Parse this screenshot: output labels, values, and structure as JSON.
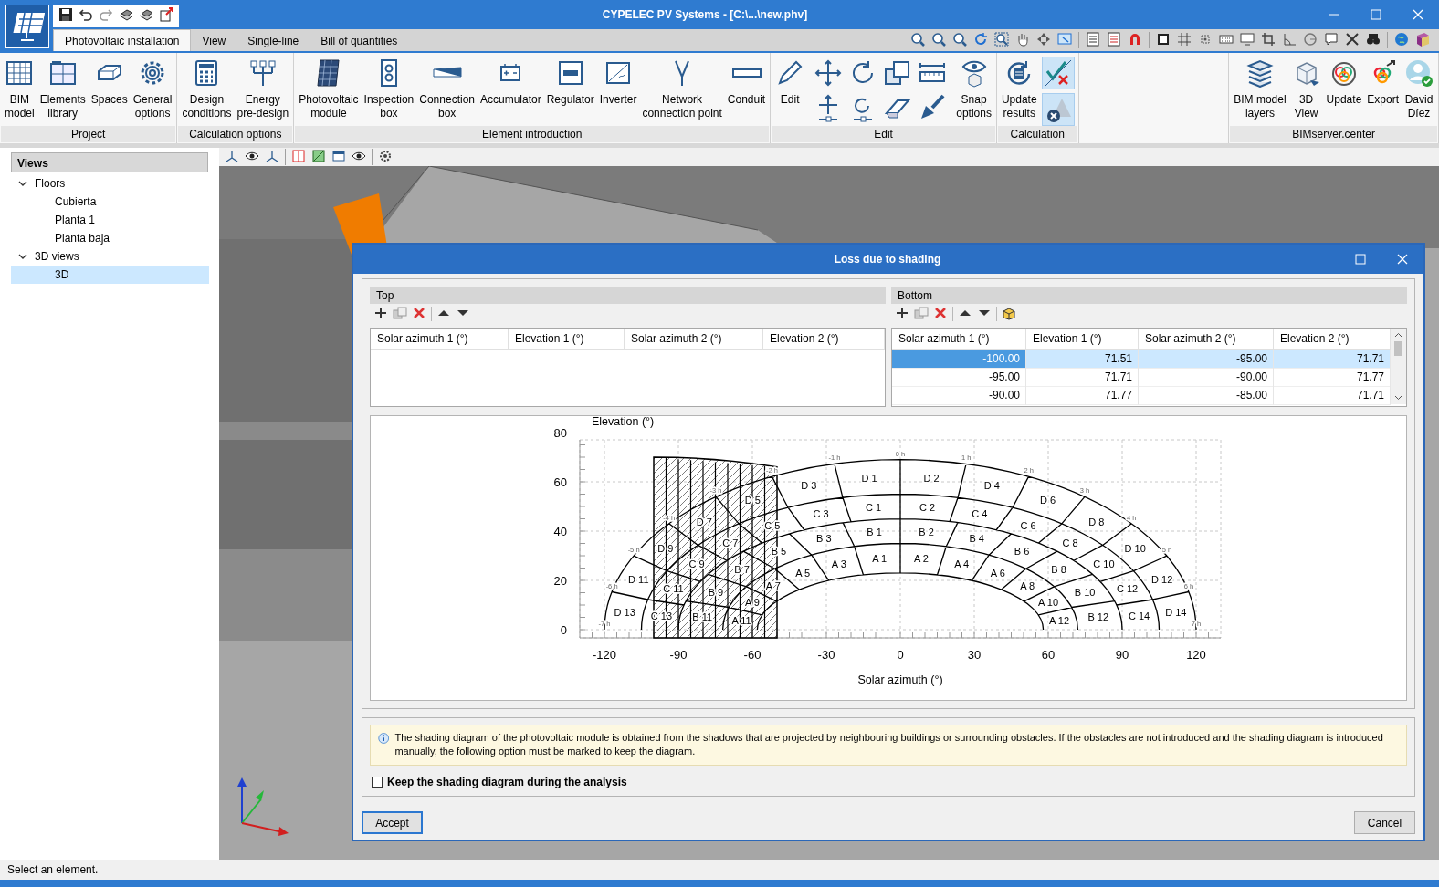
{
  "window": {
    "title": "CYPELEC PV Systems - [C:\\...\\new.phv]"
  },
  "tabs": [
    {
      "label": "Photovoltaic installation",
      "selected": true
    },
    {
      "label": "View",
      "selected": false
    },
    {
      "label": "Single-line",
      "selected": false
    },
    {
      "label": "Bill of quantities",
      "selected": false
    }
  ],
  "ribbon": {
    "groups": [
      {
        "kind": "plain",
        "label": "Project",
        "buttons": [
          {
            "label": "BIM\nmodel"
          },
          {
            "label": "Elements\nlibrary"
          },
          {
            "label": "Spaces"
          },
          {
            "label": "General\noptions"
          }
        ]
      },
      {
        "kind": "plain",
        "label": "Calculation options",
        "buttons": [
          {
            "label": "Design\nconditions"
          },
          {
            "label": "Energy\npre-design"
          }
        ]
      },
      {
        "kind": "plain",
        "label": "Element introduction",
        "buttons": [
          {
            "label": "Photovoltaic\nmodule"
          },
          {
            "label": "Inspection\nbox"
          },
          {
            "label": "Connection\nbox"
          },
          {
            "label": "Accumulator"
          },
          {
            "label": "Regulator"
          },
          {
            "label": "Inverter"
          },
          {
            "label": "Network\nconnection point"
          },
          {
            "label": "Conduit"
          }
        ]
      },
      {
        "kind": "edit",
        "label": "Edit",
        "buttons": [
          {
            "label": "Edit"
          },
          {
            "label": "Snap\noptions"
          }
        ]
      },
      {
        "kind": "calculation",
        "label": "Calculation",
        "buttons": [
          {
            "label": "Update\nresults"
          }
        ],
        "toggles": [
          {
            "pressed": true
          },
          {
            "pressed": true
          }
        ]
      },
      {
        "kind": "empty"
      },
      {
        "kind": "plain",
        "label": "BIMserver.center",
        "buttons": [
          {
            "label": "BIM model\nlayers"
          },
          {
            "label": "3D\nView"
          },
          {
            "label": "Update"
          },
          {
            "label": "Export"
          },
          {
            "label": "David\nDíez"
          }
        ]
      }
    ]
  },
  "sidebar": {
    "title": "Views",
    "tree": [
      {
        "label": "Floors",
        "expanded": true,
        "selected": false,
        "children": [
          {
            "label": "Cubierta",
            "selected": false
          },
          {
            "label": "Planta 1",
            "selected": false
          },
          {
            "label": "Planta baja",
            "selected": false
          }
        ]
      },
      {
        "label": "3D views",
        "expanded": true,
        "selected": false,
        "children": [
          {
            "label": "3D",
            "selected": true
          }
        ]
      }
    ]
  },
  "dialog": {
    "title": "Loss due to shading",
    "top": {
      "title": "Top",
      "columns": [
        "Solar azimuth 1 (°)",
        "Elevation 1 (°)",
        "Solar azimuth 2 (°)",
        "Elevation 2 (°)"
      ]
    },
    "bottom": {
      "title": "Bottom",
      "columns": [
        "Solar azimuth 1 (°)",
        "Elevation 1 (°)",
        "Solar azimuth 2 (°)",
        "Elevation 2 (°)"
      ],
      "rows": [
        {
          "cells": [
            "-100.00",
            "71.51",
            "-95.00",
            "71.71"
          ],
          "selected": true
        },
        {
          "cells": [
            "-95.00",
            "71.71",
            "-90.00",
            "71.77"
          ],
          "selected": false
        },
        {
          "cells": [
            "-90.00",
            "71.77",
            "-85.00",
            "71.71"
          ],
          "selected": false
        }
      ]
    },
    "diagram": {
      "y_title": "Elevation (°)",
      "x_title": "Solar azimuth (°)",
      "y_ticks": [
        "80",
        "60",
        "40",
        "20",
        "0"
      ],
      "x_ticks": [
        "-120",
        "-90",
        "-60",
        "-30",
        "0",
        "30",
        "60",
        "90",
        "120"
      ],
      "hour_labels": [
        "-7 h",
        "-6 h",
        "-5 h",
        "-4 h",
        "-3 h",
        "-2 h",
        "-1 h",
        "0 h",
        "1 h",
        "2 h",
        "3 h",
        "4 h",
        "5 h",
        "6 h",
        "7 h"
      ],
      "rings": [
        {
          "zones": [
            "A 1",
            "A 2",
            "A 3",
            "A 4",
            "A 5",
            "A 6",
            "A 7",
            "A 8",
            "A 9",
            "A 10",
            "A 11",
            "A 12"
          ]
        },
        {
          "zones": [
            "B 1",
            "B 2",
            "B 3",
            "B 4",
            "B 5",
            "B 6",
            "B 7",
            "B 8",
            "B 9",
            "B 10",
            "B 11",
            "B 12"
          ]
        },
        {
          "zones": [
            "C 1",
            "C 2",
            "C 3",
            "C 4",
            "C 5",
            "C 6",
            "C 7",
            "C 8",
            "C 9",
            "C 10",
            "C 11",
            "C 12",
            "C 13",
            "C 14"
          ]
        },
        {
          "zones": [
            "D 1",
            "D 2",
            "D 3",
            "D 4",
            "D 5",
            "D 6",
            "D 7",
            "D 8",
            "D 9",
            "D 10",
            "D 11",
            "D 12",
            "D 13",
            "D 14"
          ]
        }
      ]
    },
    "info": "The shading diagram of the photovoltaic module is obtained from the shadows that are projected by neighbouring buildings or surrounding obstacles. If the obstacles are not introduced and the shading diagram is introduced manually, the following option must be marked to keep the diagram.",
    "option": {
      "label": "Keep the shading diagram during the analysis",
      "checked": false
    },
    "buttons": [
      "Accept",
      "Cancel"
    ]
  },
  "status_bar": "Select an element."
}
